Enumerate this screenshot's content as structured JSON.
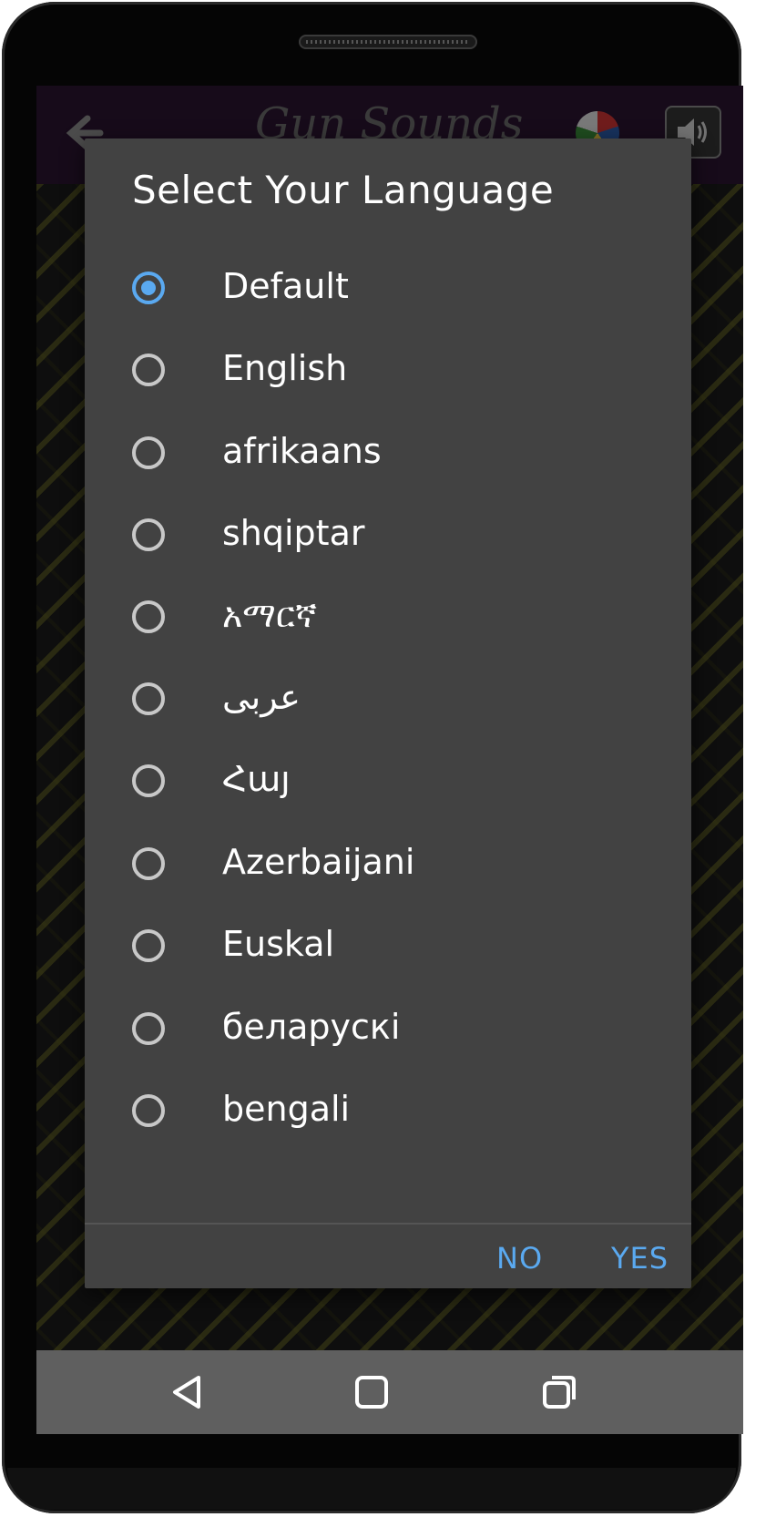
{
  "app_bar": {
    "title": "Gun Sounds",
    "icons": {
      "back": "back-arrow-icon",
      "flag": "world-flags-icon",
      "volume": "volume-icon"
    }
  },
  "dialog": {
    "title": "Select Your Language",
    "options": [
      {
        "label": "Default",
        "checked": true
      },
      {
        "label": "English",
        "checked": false
      },
      {
        "label": "afrikaans",
        "checked": false
      },
      {
        "label": "shqiptar",
        "checked": false
      },
      {
        "label": "አማርኛ",
        "checked": false
      },
      {
        "label": "عربى",
        "checked": false
      },
      {
        "label": "Հայ",
        "checked": false
      },
      {
        "label": "Azerbaijani",
        "checked": false
      },
      {
        "label": "Euskal",
        "checked": false
      },
      {
        "label": "беларускі",
        "checked": false
      },
      {
        "label": "bengali",
        "checked": false
      }
    ],
    "buttons": {
      "no": "NO",
      "yes": "YES"
    }
  },
  "nav_bar": {
    "icons": [
      "back-triangle-icon",
      "home-square-icon",
      "recents-icon"
    ]
  },
  "colors": {
    "accent": "#5aa9f0",
    "dialog_bg": "#424242",
    "app_bar_bg": "#2a1530",
    "nav_bar_bg": "#5f5f5f"
  }
}
